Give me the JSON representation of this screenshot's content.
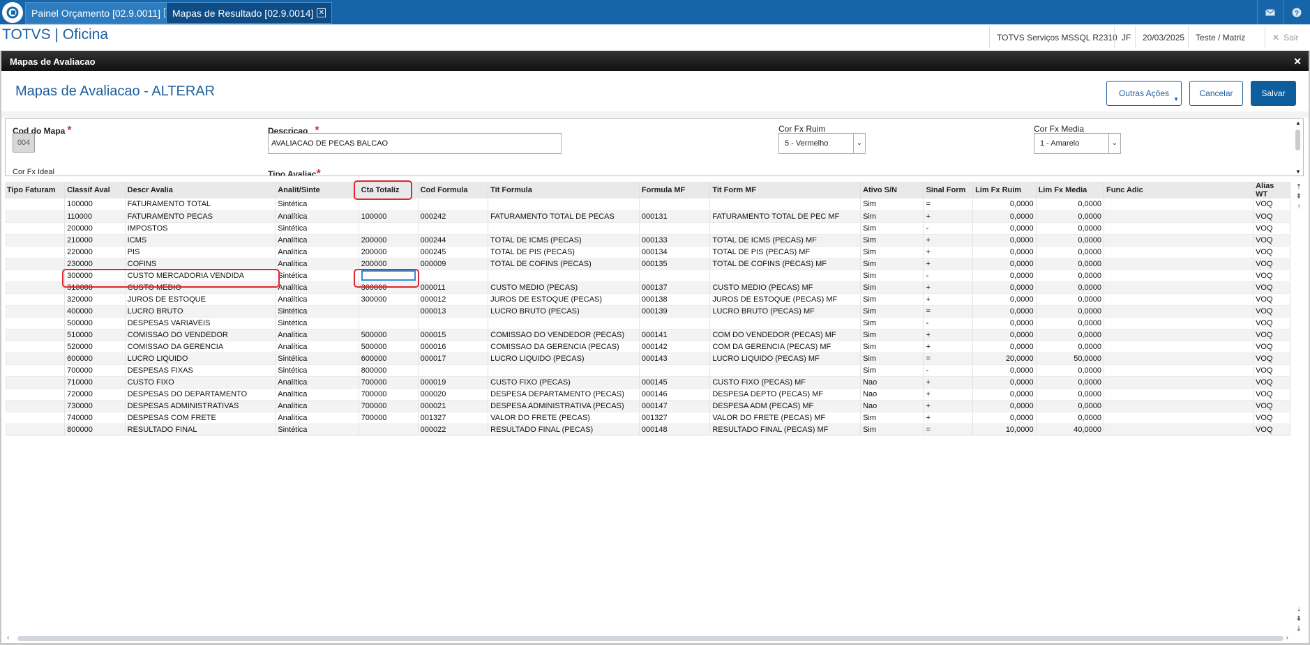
{
  "tabs": [
    {
      "label": "Painel Orçamento [02.9.0011]"
    },
    {
      "label": "Mapas de Resultado [02.9.0014]"
    }
  ],
  "header": {
    "brand": "TOTVS | Oficina",
    "info": [
      "TOTVS Serviços MSSQL R2310",
      "JF",
      "20/03/2025",
      "Teste / Matriz"
    ],
    "logout": "Sair"
  },
  "dialog": {
    "title": "Mapas de Avaliacao",
    "page_title": "Mapas de Avaliacao - ALTERAR",
    "buttons": {
      "more": "Outras Ações",
      "cancel": "Cancelar",
      "save": "Salvar"
    }
  },
  "form": {
    "cod_label": "Cod do Mapa",
    "cod_value": "004",
    "desc_label": "Descricao",
    "desc_value": "AVALIACAO DE PECAS BALCAO",
    "ruim_label": "Cor Fx Ruim",
    "ruim_value": "5 - Vermelho",
    "media_label": "Cor Fx Media",
    "media_value": "1 - Amarelo",
    "ideal_label": "Cor Fx Ideal",
    "tipo_label": "Tipo Avaliac"
  },
  "grid": {
    "columns": [
      "Tipo Faturam",
      "Classif Aval",
      "Descr Avalia",
      "Analit/Sinte",
      "Cta Totaliz",
      "Cod Formula",
      "Tit Formula",
      "Formula MF",
      "Tit Form MF",
      "Ativo S/N",
      "Sinal Form",
      "Lim Fx Ruim",
      "Lim Fx Media",
      "Func Adic",
      "Alias WT"
    ],
    "rows": [
      [
        "",
        "100000",
        "FATURAMENTO TOTAL",
        "Sintética",
        "",
        "",
        "",
        "",
        "",
        "Sim",
        "=",
        "0,0000",
        "0,0000",
        "",
        "VOQ"
      ],
      [
        "",
        "110000",
        "FATURAMENTO PECAS",
        "Analítica",
        "100000",
        "000242",
        "FATURAMENTO TOTAL DE PECAS",
        "000131",
        "FATURAMENTO TOTAL DE PEC MF",
        "Sim",
        "+",
        "0,0000",
        "0,0000",
        "",
        "VOQ"
      ],
      [
        "",
        "200000",
        "IMPOSTOS",
        "Sintética",
        "",
        "",
        "",
        "",
        "",
        "Sim",
        "-",
        "0,0000",
        "0,0000",
        "",
        "VOQ"
      ],
      [
        "",
        "210000",
        "ICMS",
        "Analítica",
        "200000",
        "000244",
        "TOTAL DE ICMS (PECAS)",
        "000133",
        "TOTAL DE ICMS (PECAS) MF",
        "Sim",
        "+",
        "0,0000",
        "0,0000",
        "",
        "VOQ"
      ],
      [
        "",
        "220000",
        "PIS",
        "Analítica",
        "200000",
        "000245",
        "TOTAL DE PIS (PECAS)",
        "000134",
        "TOTAL DE PIS (PECAS) MF",
        "Sim",
        "+",
        "0,0000",
        "0,0000",
        "",
        "VOQ"
      ],
      [
        "",
        "230000",
        "COFINS",
        "Analítica",
        "200000",
        "000009",
        "TOTAL DE COFINS (PECAS)",
        "000135",
        "TOTAL DE COFINS (PECAS) MF",
        "Sim",
        "+",
        "0,0000",
        "0,0000",
        "",
        "VOQ"
      ],
      [
        "",
        "300000",
        "CUSTO MERCADORIA VENDIDA",
        "Sintética",
        "",
        "",
        "",
        "",
        "",
        "Sim",
        "-",
        "0,0000",
        "0,0000",
        "",
        "VOQ"
      ],
      [
        "",
        "310000",
        "CUSTO MEDIO",
        "Analítica",
        "300000",
        "000011",
        "CUSTO MEDIO (PECAS)",
        "000137",
        "CUSTO MEDIO (PECAS) MF",
        "Sim",
        "+",
        "0,0000",
        "0,0000",
        "",
        "VOQ"
      ],
      [
        "",
        "320000",
        "JUROS DE ESTOQUE",
        "Analítica",
        "300000",
        "000012",
        "JUROS DE ESTOQUE (PECAS)",
        "000138",
        "JUROS DE ESTOQUE (PECAS) MF",
        "Sim",
        "+",
        "0,0000",
        "0,0000",
        "",
        "VOQ"
      ],
      [
        "",
        "400000",
        "LUCRO BRUTO",
        "Sintética",
        "",
        "000013",
        "LUCRO BRUTO (PECAS)",
        "000139",
        "LUCRO BRUTO (PECAS) MF",
        "Sim",
        "=",
        "0,0000",
        "0,0000",
        "",
        "VOQ"
      ],
      [
        "",
        "500000",
        "DESPESAS VARIAVEIS",
        "Sintética",
        "",
        "",
        "",
        "",
        "",
        "Sim",
        "-",
        "0,0000",
        "0,0000",
        "",
        "VOQ"
      ],
      [
        "",
        "510000",
        "COMISSAO DO VENDEDOR",
        "Analítica",
        "500000",
        "000015",
        "COMISSAO DO VENDEDOR (PECAS)",
        "000141",
        "COM DO VENDEDOR (PECAS) MF",
        "Sim",
        "+",
        "0,0000",
        "0,0000",
        "",
        "VOQ"
      ],
      [
        "",
        "520000",
        "COMISSAO DA GERENCIA",
        "Analítica",
        "500000",
        "000016",
        "COMISSAO DA GERENCIA (PECAS)",
        "000142",
        "COM DA GERENCIA (PECAS) MF",
        "Sim",
        "+",
        "0,0000",
        "0,0000",
        "",
        "VOQ"
      ],
      [
        "",
        "600000",
        "LUCRO LIQUIDO",
        "Sintética",
        "600000",
        "000017",
        "LUCRO LIQUIDO (PECAS)",
        "000143",
        "LUCRO LIQUIDO (PECAS) MF",
        "Sim",
        "=",
        "20,0000",
        "50,0000",
        "",
        "VOQ"
      ],
      [
        "",
        "700000",
        "DESPESAS FIXAS",
        "Sintética",
        "800000",
        "",
        "",
        "",
        "",
        "Sim",
        "-",
        "0,0000",
        "0,0000",
        "",
        "VOQ"
      ],
      [
        "",
        "710000",
        "CUSTO FIXO",
        "Analítica",
        "700000",
        "000019",
        "CUSTO FIXO (PECAS)",
        "000145",
        "CUSTO FIXO (PECAS) MF",
        "Nao",
        "+",
        "0,0000",
        "0,0000",
        "",
        "VOQ"
      ],
      [
        "",
        "720000",
        "DESPESAS DO DEPARTAMENTO",
        "Analítica",
        "700000",
        "000020",
        "DESPESA DEPARTAMENTO (PECAS)",
        "000146",
        "DESPESA DEPTO (PECAS) MF",
        "Nao",
        "+",
        "0,0000",
        "0,0000",
        "",
        "VOQ"
      ],
      [
        "",
        "730000",
        "DESPESAS ADMINISTRATIVAS",
        "Analítica",
        "700000",
        "000021",
        "DESPESA ADMINISTRATIVA (PECAS)",
        "000147",
        "DESPESA ADM (PECAS) MF",
        "Nao",
        "+",
        "0,0000",
        "0,0000",
        "",
        "VOQ"
      ],
      [
        "",
        "740000",
        "DESPESAS COM FRETE",
        "Analítica",
        "700000",
        "001327",
        "VALOR DO FRETE (PECAS)",
        "001327",
        "VALOR DO FRETE (PECAS) MF",
        "Sim",
        "+",
        "0,0000",
        "0,0000",
        "",
        "VOQ"
      ],
      [
        "",
        "800000",
        "RESULTADO FINAL",
        "Sintética",
        "",
        "000022",
        "RESULTADO FINAL (PECAS)",
        "000148",
        "RESULTADO FINAL (PECAS) MF",
        "Sim",
        "=",
        "10,0000",
        "40,0000",
        "",
        "VOQ"
      ]
    ],
    "editing_row": 6,
    "editing_col": 4
  }
}
